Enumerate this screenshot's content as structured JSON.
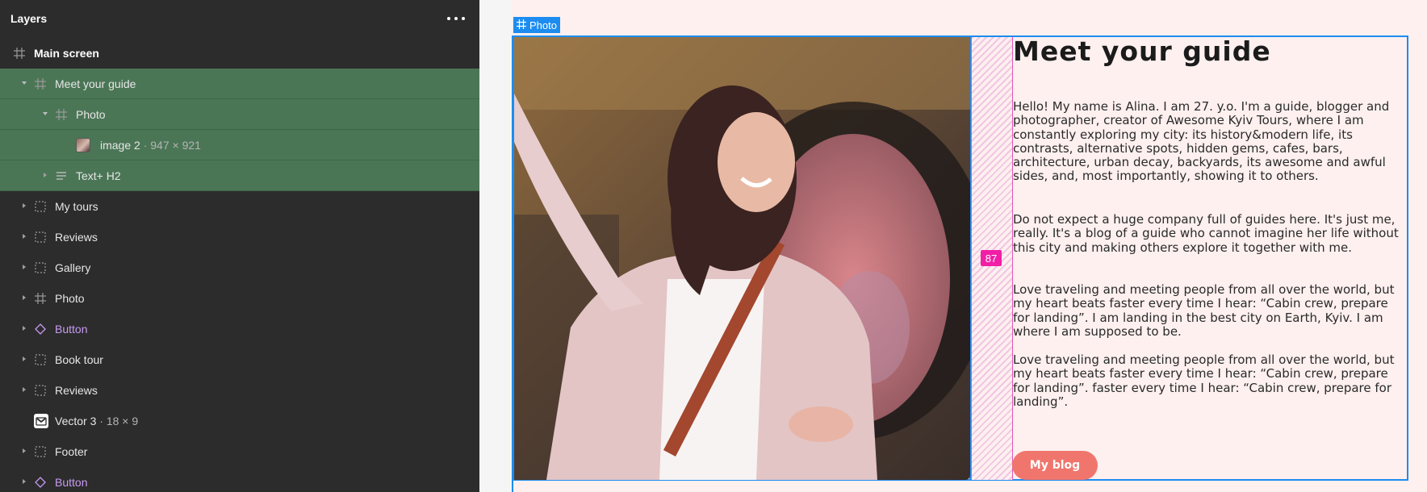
{
  "panel": {
    "title": "Layers",
    "more_icon": "more-dots-icon",
    "layers": [
      {
        "id": "main",
        "label": "Main screen",
        "icon": "frame-icon",
        "depth": 0,
        "expandable": false,
        "selected": false,
        "bold": true
      },
      {
        "id": "meet",
        "label": "Meet your guide",
        "icon": "frame-icon",
        "depth": 1,
        "expandable": true,
        "expanded": true,
        "selected": true
      },
      {
        "id": "photo-inner",
        "label": "Photo",
        "icon": "frame-icon",
        "depth": 2,
        "expandable": true,
        "expanded": true,
        "selected": true
      },
      {
        "id": "image2",
        "label": "image 2",
        "meta": " · 947 × 921",
        "icon": "image-thumbnail",
        "depth": 3,
        "expandable": false,
        "selected": true
      },
      {
        "id": "texth2",
        "label": "Text+ H2",
        "icon": "text-icon",
        "depth": 2,
        "expandable": true,
        "expanded": false,
        "selected": true
      },
      {
        "id": "mytours",
        "label": "My tours",
        "icon": "group-icon",
        "depth": 1,
        "expandable": true,
        "expanded": false,
        "selected": false
      },
      {
        "id": "reviews1",
        "label": "Reviews",
        "icon": "group-icon",
        "depth": 1,
        "expandable": true,
        "expanded": false,
        "selected": false
      },
      {
        "id": "gallery",
        "label": "Gallery",
        "icon": "group-icon",
        "depth": 1,
        "expandable": true,
        "expanded": false,
        "selected": false
      },
      {
        "id": "photo",
        "label": "Photo",
        "icon": "frame-icon",
        "depth": 1,
        "expandable": true,
        "expanded": false,
        "selected": false
      },
      {
        "id": "button1",
        "label": "Button",
        "icon": "component-instance-icon",
        "depth": 1,
        "expandable": true,
        "expanded": false,
        "selected": false,
        "purple": true
      },
      {
        "id": "booktour",
        "label": "Book tour",
        "icon": "group-icon",
        "depth": 1,
        "expandable": true,
        "expanded": false,
        "selected": false
      },
      {
        "id": "reviews2",
        "label": "Reviews",
        "icon": "group-icon",
        "depth": 1,
        "expandable": true,
        "expanded": false,
        "selected": false
      },
      {
        "id": "vector3",
        "label": "Vector 3",
        "meta": " · 18 × 9",
        "icon": "vector-icon",
        "depth": 1,
        "expandable": false,
        "selected": false
      },
      {
        "id": "footer",
        "label": "Footer",
        "icon": "group-icon",
        "depth": 1,
        "expandable": true,
        "expanded": false,
        "selected": false
      },
      {
        "id": "button2",
        "label": "Button",
        "icon": "component-instance-icon",
        "depth": 1,
        "expandable": true,
        "expanded": false,
        "selected": false,
        "purple": true
      }
    ]
  },
  "canvas": {
    "frame_tag": "Photo",
    "spacing_badge": "87",
    "heading": "Meet your guide",
    "paragraphs": [
      "Hello! My name is Alina. I am 27. y.o. I'm a guide, blogger and photographer, creator of Awesome Kyiv Tours, where I am constantly exploring my city: its history&modern life, its contrasts, alternative spots, hidden gems, cafes, bars, architecture, urban decay, backyards, its awesome and awful sides, and, most importantly, showing it to others.",
      "Do not expect a huge company full of guides here. It's just me, really. It's a blog of a guide who cannot imagine her life without this city and making others explore it together with me.",
      "Love traveling and meeting people from all over the world, but my heart beats faster every time I hear: “Cabin crew, prepare for landing”. I am landing in the best city on Earth, Kyiv. I am where I am supposed to be.",
      "Love traveling and meeting people from all over the world, but my heart beats faster every time I hear: “Cabin crew, prepare for landing”. faster every time I hear: “Cabin crew, prepare for landing”."
    ],
    "button_label": "My blog",
    "colors": {
      "selection_blue": "#1d8cf0",
      "spacing_pink": "#f01fa6",
      "layer_selected": "#4b7656",
      "frame_bg": "#fdf0ef",
      "button": "#f0766d"
    }
  }
}
